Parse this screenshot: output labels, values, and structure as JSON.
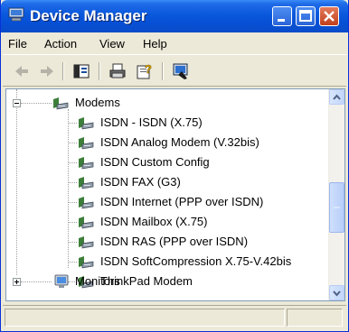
{
  "window": {
    "title": "Device Manager"
  },
  "menu": [
    "File",
    "Action",
    "View",
    "Help"
  ],
  "tree": {
    "group": "Modems",
    "children": [
      "ISDN - ISDN (X.75)",
      "ISDN Analog Modem (V.32bis)",
      "ISDN Custom Config",
      "ISDN FAX (G3)",
      "ISDN Internet (PPP over ISDN)",
      "ISDN Mailbox (X.75)",
      "ISDN RAS (PPP over ISDN)",
      "ISDN SoftCompression X.75-V.42bis",
      "ThinkPad Modem"
    ],
    "next_group": "Monitors"
  },
  "scroll": {
    "position_fraction": 0.6
  }
}
